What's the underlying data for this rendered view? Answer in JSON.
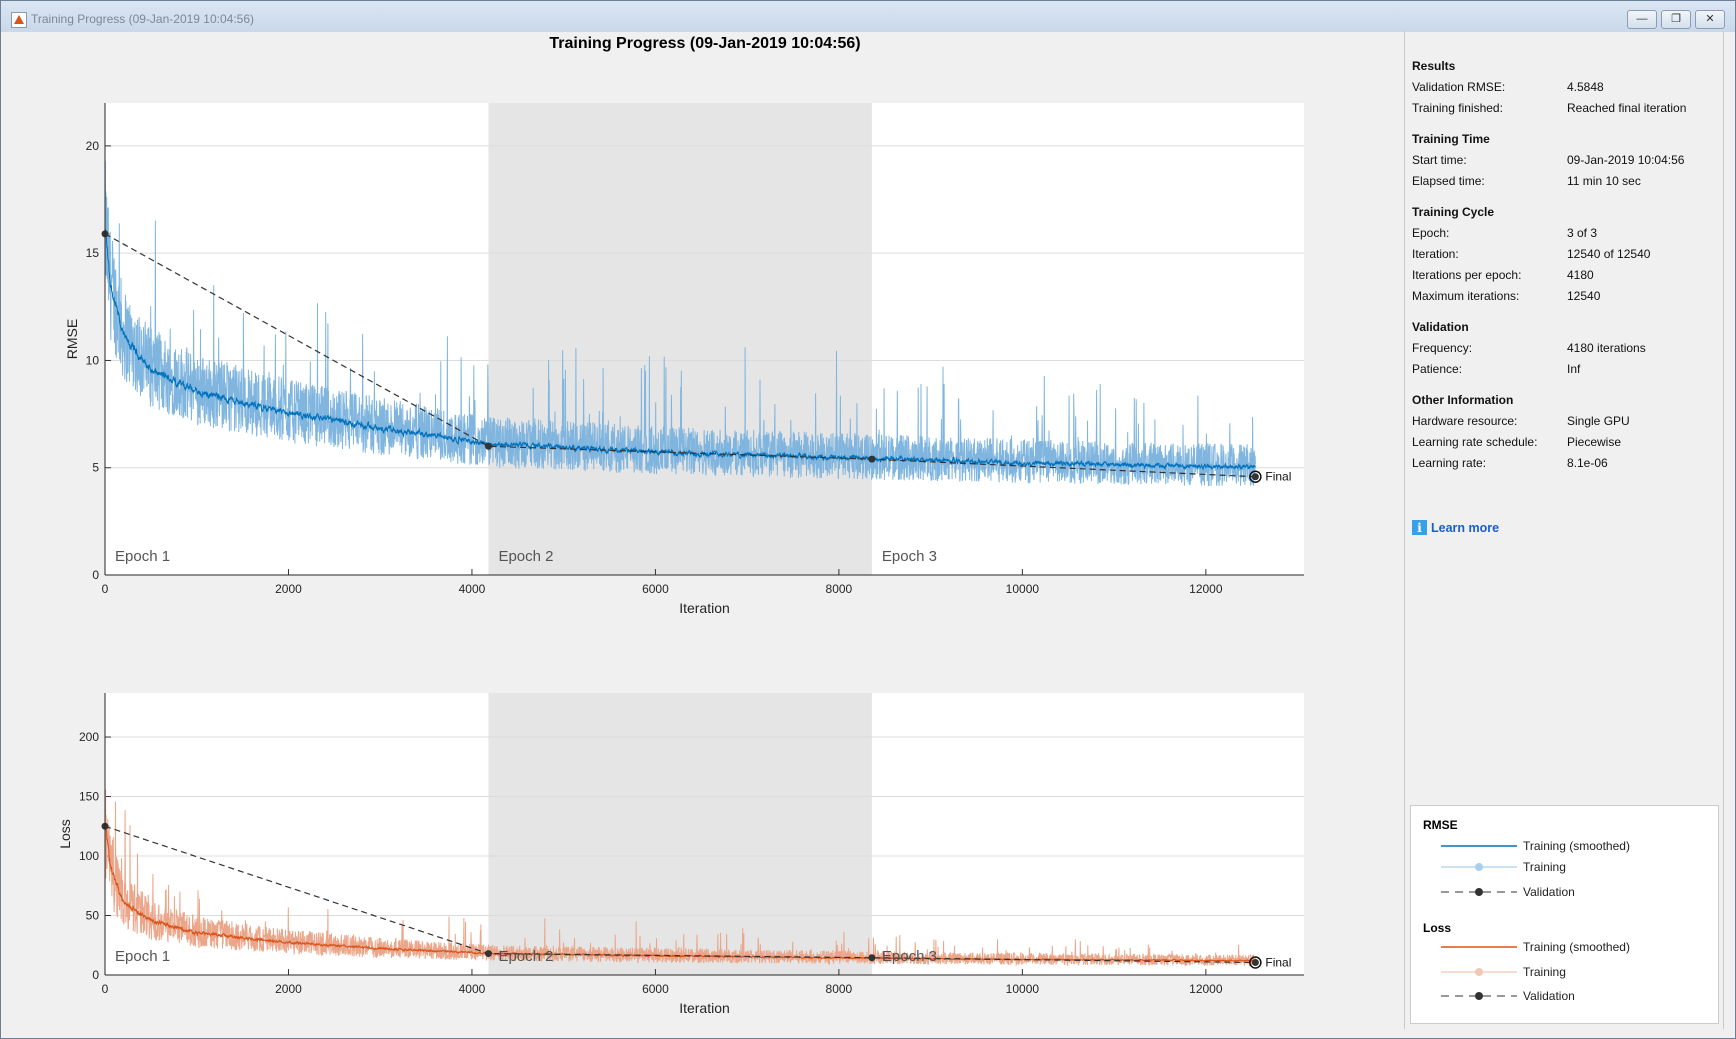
{
  "window": {
    "title": "Training Progress (09-Jan-2019 10:04:56)",
    "minimize": "—",
    "maximize": "❐",
    "close": "✕"
  },
  "figure_title": "Training Progress (09-Jan-2019 10:04:56)",
  "colors": {
    "rmse_smoothed": "#0072bd",
    "rmse_raw": "#7fb5de",
    "loss_smoothed": "#d95319",
    "loss_raw": "#eba68a",
    "validation": "#333333",
    "epoch_shade": "#e5e5e5"
  },
  "info": {
    "sections": [
      {
        "title": "Results",
        "rows": [
          [
            "Validation RMSE:",
            "4.5848"
          ],
          [
            "Training finished:",
            "Reached final iteration"
          ]
        ]
      },
      {
        "title": "Training Time",
        "rows": [
          [
            "Start time:",
            "09-Jan-2019 10:04:56"
          ],
          [
            "Elapsed time:",
            "11 min 10 sec"
          ]
        ]
      },
      {
        "title": "Training Cycle",
        "rows": [
          [
            "Epoch:",
            "3 of 3"
          ],
          [
            "Iteration:",
            "12540 of 12540"
          ],
          [
            "Iterations per epoch:",
            "4180"
          ],
          [
            "Maximum iterations:",
            "12540"
          ]
        ]
      },
      {
        "title": "Validation",
        "rows": [
          [
            "Frequency:",
            "4180 iterations"
          ],
          [
            "Patience:",
            "Inf"
          ]
        ]
      },
      {
        "title": "Other Information",
        "rows": [
          [
            "Hardware resource:",
            "Single GPU"
          ],
          [
            "Learning rate schedule:",
            "Piecewise"
          ],
          [
            "Learning rate:",
            "8.1e-06"
          ]
        ]
      }
    ],
    "learn_more": "Learn more"
  },
  "legend": {
    "rmse_title": "RMSE",
    "loss_title": "Loss",
    "smoothed": "Training (smoothed)",
    "training": "Training",
    "validation": "Validation"
  },
  "chart_data": [
    {
      "type": "line",
      "name": "rmse",
      "xlabel": "Iteration",
      "ylabel": "RMSE",
      "xlim": [
        0,
        13070
      ],
      "ylim": [
        0,
        22
      ],
      "xticks": [
        0,
        2000,
        4000,
        6000,
        8000,
        10000,
        12000
      ],
      "yticks": [
        0,
        5,
        10,
        15,
        20
      ],
      "epochs": [
        {
          "label": "Epoch 1",
          "start": 0,
          "end": 4180
        },
        {
          "label": "Epoch 2",
          "start": 4180,
          "end": 8360
        },
        {
          "label": "Epoch 3",
          "start": 8360,
          "end": 12540
        }
      ],
      "smoothed": {
        "x": [
          0,
          50,
          200,
          500,
          1000,
          2000,
          3000,
          4180,
          6000,
          8360,
          10000,
          12540
        ],
        "y": [
          16,
          13.5,
          11,
          9.5,
          8.5,
          7.5,
          6.8,
          6.1,
          5.7,
          5.4,
          5.2,
          5.0
        ]
      },
      "raw_noise_scale": 0.18,
      "validation": {
        "x": [
          0,
          4180,
          8360,
          12540
        ],
        "y": [
          15.9,
          6.0,
          5.4,
          4.58
        ]
      },
      "final_label": "Final"
    },
    {
      "type": "line",
      "name": "loss",
      "xlabel": "Iteration",
      "ylabel": "Loss",
      "xlim": [
        0,
        13070
      ],
      "ylim": [
        0,
        237
      ],
      "xticks": [
        0,
        2000,
        4000,
        6000,
        8000,
        10000,
        12000
      ],
      "yticks": [
        0,
        50,
        100,
        150,
        200
      ],
      "epochs": [
        {
          "label": "Epoch 1",
          "start": 0,
          "end": 4180
        },
        {
          "label": "Epoch 2",
          "start": 4180,
          "end": 8360
        },
        {
          "label": "Epoch 3",
          "start": 8360,
          "end": 12540
        }
      ],
      "smoothed": {
        "x": [
          0,
          50,
          200,
          500,
          1000,
          2000,
          3000,
          4180,
          6000,
          8360,
          10000,
          12540
        ],
        "y": [
          125,
          90,
          60,
          45,
          35,
          27,
          22,
          18,
          16,
          14,
          13,
          12
        ]
      },
      "raw_noise_scale": 0.35,
      "validation": {
        "x": [
          0,
          4180,
          8360,
          12540
        ],
        "y": [
          125,
          18,
          14.5,
          10.5
        ]
      },
      "final_label": "Final"
    }
  ]
}
